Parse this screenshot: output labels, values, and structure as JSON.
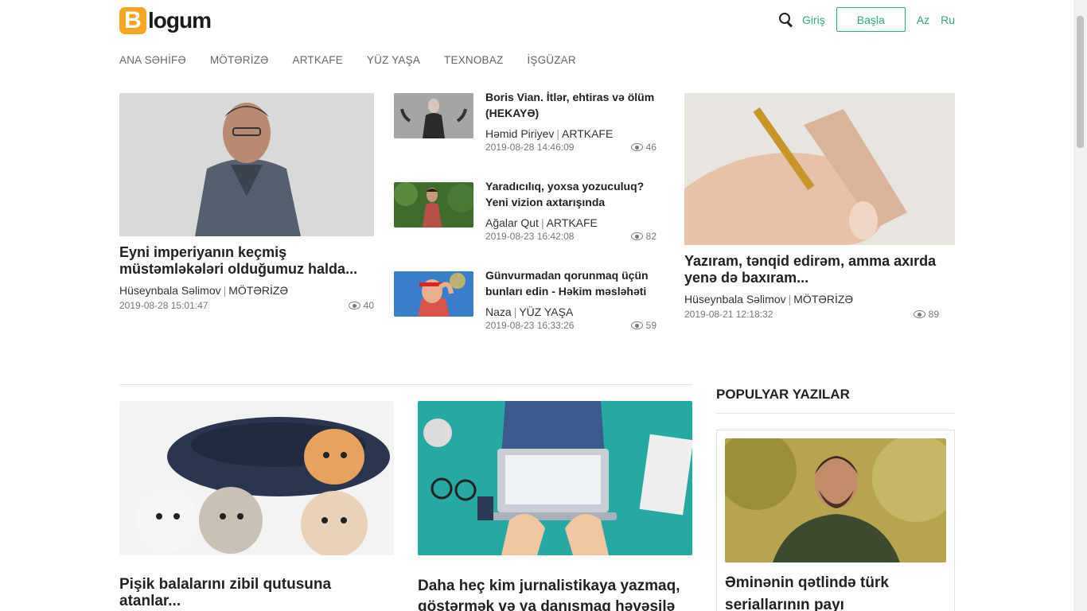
{
  "header": {
    "logo_mark": "B",
    "logo_text": "logum",
    "login": "Giriş",
    "start": "Başla",
    "lang_az": "Az",
    "lang_ru": "Ru"
  },
  "nav": [
    "ANA SƏHİFƏ",
    "MÖTƏRİZƏ",
    "ARTKAFE",
    "YÜZ YAŞA",
    "TEXNOBAZ",
    "İŞGÜZAR"
  ],
  "featured": [
    {
      "title": "Eyni imperiyanın keçmiş müstəmləkələri olduğumuz halda...",
      "author": "Hüseynbala Səlimov",
      "category": "MÖTƏRİZƏ",
      "date": "2019-08-28 15:01:47",
      "views": "40"
    },
    {
      "title": "Boris Vian. İtlər, ehtiras və ölüm (HEKAYƏ)",
      "author": "Həmid Piriyev",
      "category": "ARTKAFE",
      "date": "2019-08-28 14:46:09",
      "views": "46"
    },
    {
      "title": "Yaradıcılıq, yoxsa yozuculuq? Yeni vizion axtarışında",
      "author": "Ağalar Qut",
      "category": "ARTKAFE",
      "date": "2019-08-23 16:42:08",
      "views": "82"
    },
    {
      "title": "Günvurmadan qorunmaq üçün bunları edin - Həkim məsləhəti",
      "author": "Naza",
      "category": "YÜZ YAŞA",
      "date": "2019-08-23 16:33:26",
      "views": "59"
    },
    {
      "title": "Yazıram, tənqid edirəm, amma axırda yenə də baxıram...",
      "author": "Hüseynbala Səlimov",
      "category": "MÖTƏRİZƏ",
      "date": "2019-08-21 12:18:32",
      "views": "89"
    }
  ],
  "articles": [
    {
      "title": "Pişik balalarını zibil qutusuna atanlar..."
    },
    {
      "title": "Daha heç kim jurnalistikaya yazmaq, göstərmək və ya danışmaq həvəsilə"
    }
  ],
  "popular": {
    "heading": "POPULYAR YAZILAR",
    "title": "Əminənin qətlində türk seriallarının payı"
  }
}
